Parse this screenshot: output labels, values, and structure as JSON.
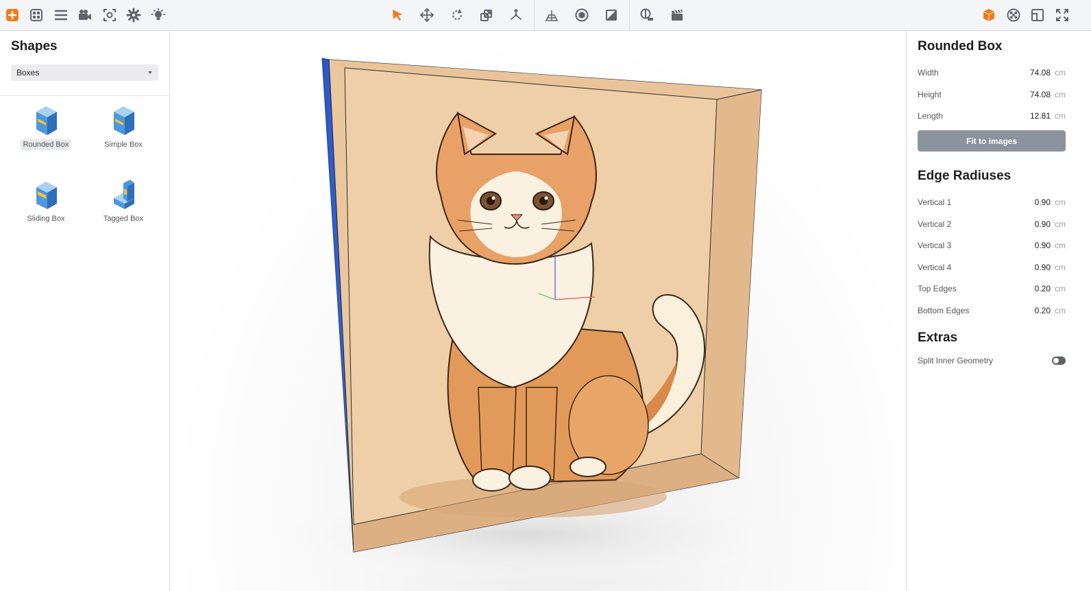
{
  "toolbar": {
    "left_icons": [
      "add-icon",
      "grid-icon",
      "menu-icon",
      "camera-icon",
      "focus-icon",
      "gear-icon",
      "light-icon"
    ],
    "center_icons": [
      "select-arrow-icon",
      "move-icon",
      "rotate-icon",
      "scale-icon",
      "axes-icon",
      "floor-grid-icon",
      "orbit-icon",
      "texture-icon",
      "render-icon",
      "clapper-icon"
    ],
    "right_icons": [
      "box-view-icon",
      "material-icon",
      "layout-icon",
      "fullscreen-icon"
    ],
    "colors": {
      "accent": "#f07c1e",
      "icon": "#5e636c"
    }
  },
  "left_panel": {
    "title": "Shapes",
    "category": "Boxes",
    "shapes": [
      {
        "label": "Rounded Box",
        "icon": "rounded-box-icon",
        "selected": true
      },
      {
        "label": "Simple Box",
        "icon": "simple-box-icon",
        "selected": false
      },
      {
        "label": "Sliding Box",
        "icon": "sliding-box-icon",
        "selected": false
      },
      {
        "label": "Tagged Box",
        "icon": "tagged-box-icon",
        "selected": false
      }
    ]
  },
  "right_panel": {
    "title": "Rounded Box",
    "dimensions": [
      {
        "label": "Width",
        "value": "74.08",
        "unit": "cm"
      },
      {
        "label": "Height",
        "value": "74.08",
        "unit": "cm"
      },
      {
        "label": "Length",
        "value": "12.81",
        "unit": "cm"
      }
    ],
    "fit_button": "Fit to images",
    "edge_title": "Edge Radiuses",
    "edges": [
      {
        "label": "Vertical 1",
        "value": "0.90",
        "unit": "cm"
      },
      {
        "label": "Vertical 2",
        "value": "0.90",
        "unit": "cm"
      },
      {
        "label": "Vertical 3",
        "value": "0.90",
        "unit": "cm"
      },
      {
        "label": "Vertical 4",
        "value": "0.90",
        "unit": "cm"
      },
      {
        "label": "Top Edges",
        "value": "0.20",
        "unit": "cm"
      },
      {
        "label": "Bottom Edges",
        "value": "0.20",
        "unit": "cm"
      }
    ],
    "extras_title": "Extras",
    "extras": [
      {
        "label": "Split Inner Geometry",
        "toggle": false
      }
    ]
  }
}
